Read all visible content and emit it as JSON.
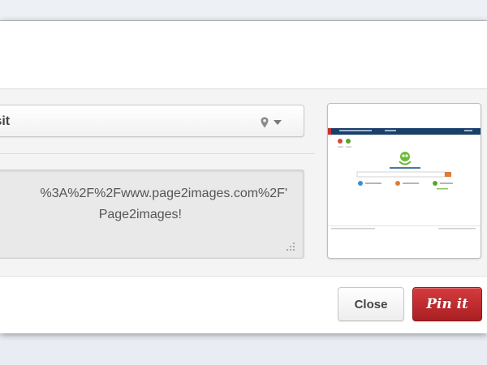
{
  "board": {
    "selected": "isit",
    "location_icon": "map-marker-icon",
    "caret_icon": "caret-down-icon"
  },
  "description": {
    "line1": "%3A%2F%2Fwww.page2images.com%2F'",
    "line2": "Page2images!"
  },
  "thumbnail": {
    "alt_icon": "webpage-screenshot-thumbnail"
  },
  "footer": {
    "close_label": "Close",
    "pin_label": "Pin it"
  },
  "colors": {
    "pin_red": "#c62d30",
    "thumb_header": "#1a3f6b",
    "thumb_green": "#5aa52b",
    "thumb_orange": "#e07b39"
  }
}
